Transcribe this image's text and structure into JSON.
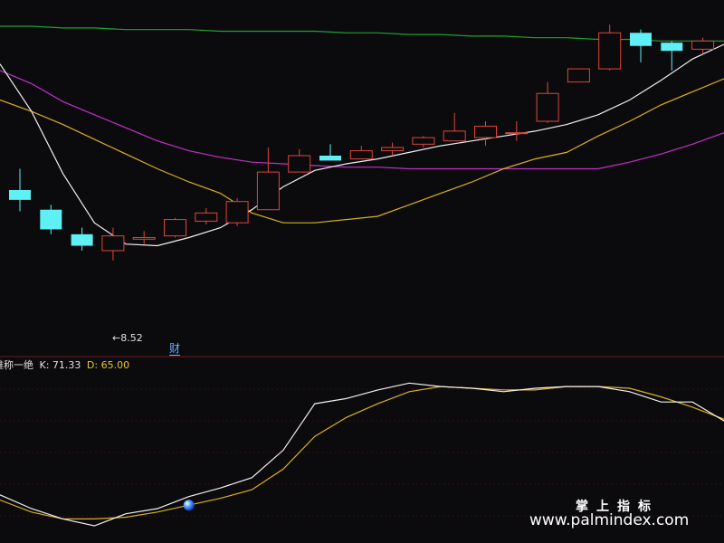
{
  "colors": {
    "background": "#0b0b0e",
    "up": "#e0453a",
    "down": "#5ff0f5",
    "ma_white": "#f0f0f0",
    "ma_yellow": "#d9b020",
    "ma_magenta": "#c032c8",
    "ma_green": "#20a030",
    "k_line": "#f0f0f0",
    "d_line": "#d9b020",
    "grid": "#3a0c10",
    "k_label": "#e0e0e0",
    "d_label": "#e8c830"
  },
  "indicator": {
    "name": "难称一绝",
    "k_label": "K: 71.33",
    "d_label": "D: 65.00"
  },
  "annotations": {
    "low_price": "←8.52",
    "finance_marker": "财"
  },
  "watermark": {
    "cn": "掌上指标",
    "url": "www.palmindex.com"
  },
  "chart_data": [
    {
      "type": "candlestick",
      "title": "",
      "price_range": [
        7.9,
        10.0
      ],
      "candles": [
        {
          "o": 8.95,
          "h": 9.08,
          "l": 8.82,
          "c": 8.89
        },
        {
          "o": 8.83,
          "h": 8.86,
          "l": 8.68,
          "c": 8.71
        },
        {
          "o": 8.68,
          "h": 8.72,
          "l": 8.58,
          "c": 8.61
        },
        {
          "o": 8.58,
          "h": 8.72,
          "l": 8.52,
          "c": 8.67
        },
        {
          "o": 8.65,
          "h": 8.7,
          "l": 8.62,
          "c": 8.66
        },
        {
          "o": 8.67,
          "h": 8.78,
          "l": 8.66,
          "c": 8.77
        },
        {
          "o": 8.76,
          "h": 8.84,
          "l": 8.74,
          "c": 8.81
        },
        {
          "o": 8.75,
          "h": 8.9,
          "l": 8.73,
          "c": 8.88
        },
        {
          "o": 8.83,
          "h": 9.21,
          "l": 8.83,
          "c": 9.06
        },
        {
          "o": 9.06,
          "h": 9.2,
          "l": 9.06,
          "c": 9.16
        },
        {
          "o": 9.16,
          "h": 9.23,
          "l": 9.16,
          "c": 9.13
        },
        {
          "o": 9.14,
          "h": 9.22,
          "l": 9.14,
          "c": 9.19
        },
        {
          "o": 9.19,
          "h": 9.24,
          "l": 9.16,
          "c": 9.21
        },
        {
          "o": 9.23,
          "h": 9.28,
          "l": 9.21,
          "c": 9.27
        },
        {
          "o": 9.25,
          "h": 9.42,
          "l": 9.25,
          "c": 9.31
        },
        {
          "o": 9.27,
          "h": 9.37,
          "l": 9.22,
          "c": 9.34
        },
        {
          "o": 9.3,
          "h": 9.37,
          "l": 9.25,
          "c": 9.3
        },
        {
          "o": 9.37,
          "h": 9.61,
          "l": 9.36,
          "c": 9.54
        },
        {
          "o": 9.61,
          "h": 9.65,
          "l": 9.61,
          "c": 9.69
        },
        {
          "o": 9.69,
          "h": 9.96,
          "l": 9.68,
          "c": 9.91
        },
        {
          "o": 9.91,
          "h": 9.93,
          "l": 9.73,
          "c": 9.83
        },
        {
          "o": 9.85,
          "h": 9.86,
          "l": 9.68,
          "c": 9.8
        },
        {
          "o": 9.81,
          "h": 9.88,
          "l": 9.78,
          "c": 9.86
        }
      ],
      "ma_white": [
        9.72,
        9.43,
        9.05,
        8.75,
        8.62,
        8.61,
        8.66,
        8.72,
        8.83,
        8.97,
        9.07,
        9.11,
        9.14,
        9.18,
        9.22,
        9.25,
        9.28,
        9.31,
        9.35,
        9.41,
        9.5,
        9.62,
        9.75,
        9.84
      ],
      "ma_yellow": [
        9.5,
        9.43,
        9.35,
        9.26,
        9.17,
        9.08,
        9.0,
        8.93,
        8.81,
        8.75,
        8.75,
        8.77,
        8.79,
        8.86,
        8.93,
        9.0,
        9.08,
        9.14,
        9.18,
        9.28,
        9.37,
        9.47,
        9.55,
        9.63
      ],
      "ma_magenta": [
        9.68,
        9.6,
        9.49,
        9.41,
        9.33,
        9.25,
        9.19,
        9.15,
        9.12,
        9.11,
        9.1,
        9.09,
        9.09,
        9.08,
        9.08,
        9.08,
        9.08,
        9.08,
        9.08,
        9.08,
        9.12,
        9.17,
        9.23,
        9.3
      ],
      "ma_green": [
        9.95,
        9.95,
        9.94,
        9.94,
        9.93,
        9.93,
        9.93,
        9.92,
        9.92,
        9.92,
        9.92,
        9.91,
        9.91,
        9.9,
        9.9,
        9.89,
        9.89,
        9.88,
        9.88,
        9.87,
        9.87,
        9.86,
        9.86,
        9.86
      ]
    },
    {
      "type": "line",
      "title": "",
      "ylim": [
        0,
        100
      ],
      "series": [
        {
          "name": "K",
          "values": [
            28,
            20,
            14,
            10,
            17,
            20,
            27,
            32,
            38,
            54,
            81,
            84,
            89,
            93,
            91,
            90,
            88,
            90,
            91,
            91,
            88,
            82,
            82,
            71
          ]
        },
        {
          "name": "D",
          "values": [
            25,
            18,
            14,
            14,
            15,
            18,
            22,
            26,
            31,
            43,
            62,
            73,
            81,
            88,
            91,
            90,
            89,
            89,
            91,
            91,
            90,
            85,
            79,
            72
          ]
        }
      ],
      "marker_index": 6
    }
  ]
}
